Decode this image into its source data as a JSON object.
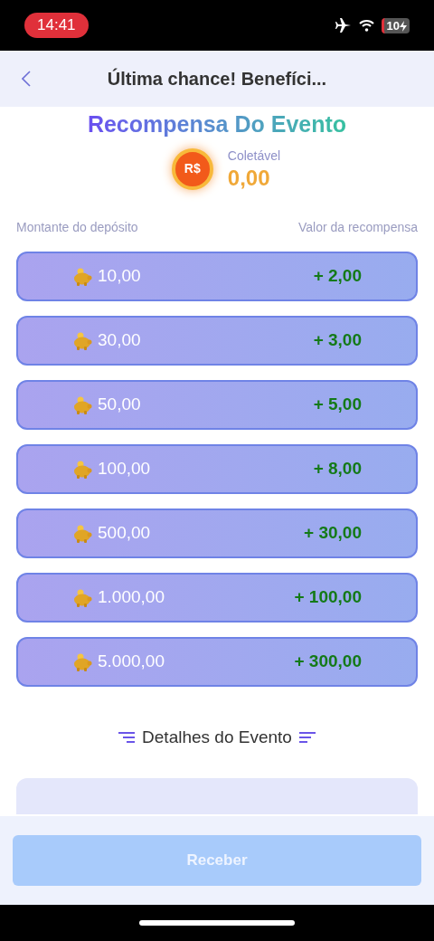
{
  "status_bar": {
    "time": "14:41",
    "battery": "10"
  },
  "header": {
    "title": "Última chance! Benefíci..."
  },
  "event": {
    "heading": "Recompensa Do Evento",
    "collectable_label": "Coletável",
    "collectable_value": "0,00",
    "coin": "R$"
  },
  "table": {
    "columns": [
      "Montante do depósito",
      "Valor da recompensa"
    ],
    "rows": [
      {
        "deposit": "10,00",
        "reward": "+ 2,00"
      },
      {
        "deposit": "30,00",
        "reward": "+ 3,00"
      },
      {
        "deposit": "50,00",
        "reward": "+ 5,00"
      },
      {
        "deposit": "100,00",
        "reward": "+ 8,00"
      },
      {
        "deposit": "500,00",
        "reward": "+ 30,00"
      },
      {
        "deposit": "1.000,00",
        "reward": "+ 100,00"
      },
      {
        "deposit": "5.000,00",
        "reward": "+ 300,00"
      }
    ]
  },
  "details": {
    "title": "Detalhes do Evento"
  },
  "footer": {
    "button": "Receber",
    "disabled": true
  }
}
